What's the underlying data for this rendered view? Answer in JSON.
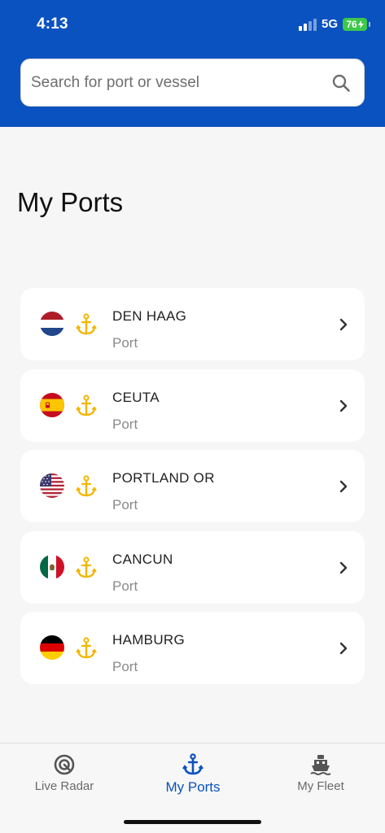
{
  "status_bar": {
    "time": "4:13",
    "network": "5G",
    "battery": "76"
  },
  "search": {
    "placeholder": "Search for port or vessel",
    "icon": "search-icon"
  },
  "page": {
    "title": "My Ports"
  },
  "ports": [
    {
      "name": "DEN HAAG",
      "type": "Port",
      "flag": "netherlands"
    },
    {
      "name": "CEUTA",
      "type": "Port",
      "flag": "spain"
    },
    {
      "name": "PORTLAND OR",
      "type": "Port",
      "flag": "usa"
    },
    {
      "name": "CANCUN",
      "type": "Port",
      "flag": "mexico"
    },
    {
      "name": "HAMBURG",
      "type": "Port",
      "flag": "germany"
    }
  ],
  "tabs": [
    {
      "label": "Live Radar",
      "icon": "radar-icon",
      "active": false
    },
    {
      "label": "My Ports",
      "icon": "anchor-icon",
      "active": true
    },
    {
      "label": "My Fleet",
      "icon": "ship-icon",
      "active": false
    }
  ],
  "colors": {
    "brand": "#0a52bf",
    "anchor": "#f2b705",
    "battery": "#3cc84a"
  }
}
